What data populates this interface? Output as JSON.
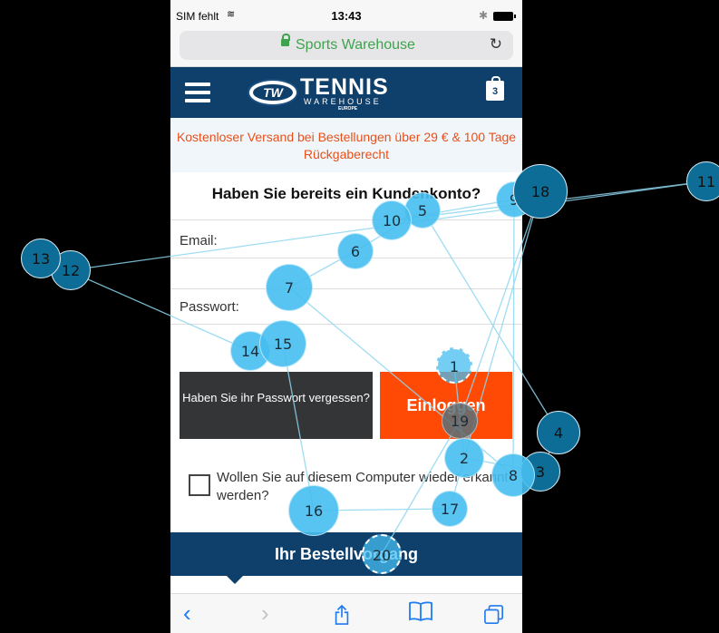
{
  "status_bar": {
    "carrier": "SIM fehlt",
    "time": "13:43"
  },
  "browser": {
    "url": "Sports Warehouse"
  },
  "header": {
    "logo_badge": "TW",
    "logo_title": "TENNIS",
    "logo_subtitle": "WAREHOUSE",
    "logo_region": "EUROPE",
    "cart_count": "3"
  },
  "promo": {
    "text": "Kostenloser Versand bei Bestellungen über 29 € & 100 Tage Rückgaberecht"
  },
  "login": {
    "heading": "Haben Sie bereits ein Kundenkonto?",
    "email_label": "Email:",
    "password_label": "Passwort:",
    "forgot_button": "Haben Sie ihr Passwort vergessen?",
    "login_button": "Einloggen",
    "remember_label": "Wollen Sie auf diesem Computer wieder erkannt werden?"
  },
  "checkout": {
    "label": "Ihr Bestellvorgang"
  },
  "toolbar": {
    "back_icon": "back-icon",
    "forward_icon": "forward-icon",
    "share_icon": "share-icon",
    "bookmarks_icon": "bookmarks-icon",
    "tabs_icon": "tabs-icon"
  },
  "gaze_overlay": {
    "fixations": [
      "1",
      "2",
      "3",
      "4",
      "5",
      "6",
      "7",
      "8",
      "9",
      "10",
      "11",
      "12",
      "13",
      "14",
      "15",
      "16",
      "17",
      "18",
      "19",
      "20"
    ],
    "colors": {
      "fixation": "#46bef0",
      "fixation_dark": "#0d6d97",
      "path": "#8fd6f0"
    }
  }
}
